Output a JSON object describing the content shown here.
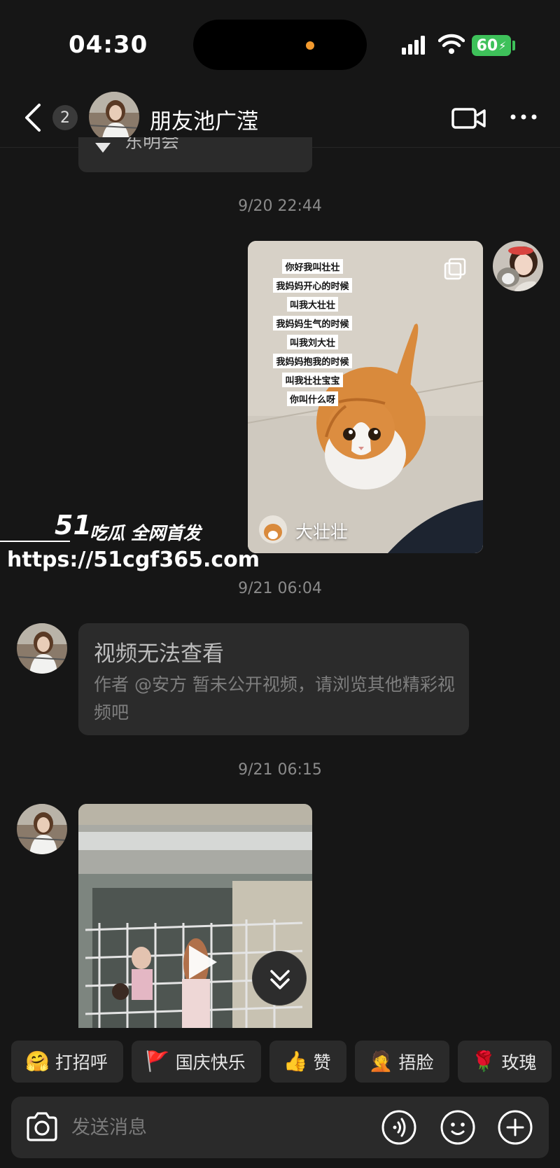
{
  "status_bar": {
    "time": "04:30",
    "battery": "60"
  },
  "header": {
    "back_badge": "2",
    "title": "朋友池广滢"
  },
  "partial_bubble": {
    "text": "东明会"
  },
  "messages": {
    "ts1": "9/20 22:44",
    "cat_video": {
      "caption_lines": [
        "你好我叫壮壮",
        "我妈妈开心的时候",
        "叫我大壮壮",
        "我妈妈生气的时候",
        "叫我刘大壮",
        "我妈妈抱我的时候",
        "叫我壮壮宝宝",
        "你叫什么呀"
      ],
      "author": "大壮壮"
    },
    "ts2": "9/21 06:04",
    "unavailable": {
      "title": "视频无法查看",
      "body": "作者 @安方 暂未公开视频，请浏览其他精彩视频吧"
    },
    "ts3": "9/21 06:15"
  },
  "watermark": {
    "logo": "51",
    "title": "吃瓜 全网首发",
    "url": "https://51cgf365.com"
  },
  "quick_replies": [
    {
      "emoji": "🤗",
      "label": "打招呼"
    },
    {
      "emoji": "🚩",
      "label": "国庆快乐"
    },
    {
      "emoji": "👍",
      "label": "赞"
    },
    {
      "emoji": "🤦",
      "label": "捂脸"
    },
    {
      "emoji": "🌹",
      "label": "玫瑰"
    }
  ],
  "input": {
    "placeholder": "发送消息"
  },
  "colors": {
    "background": "#161616",
    "bubble": "#2b2b2b",
    "battery": "#3ec15a",
    "island_dot": "#f29a2e"
  },
  "icons": [
    "back-icon",
    "video-call-icon",
    "more-icon",
    "copy-icon",
    "play-icon",
    "double-chevron-down-icon",
    "camera-icon",
    "voice-icon",
    "emoji-icon",
    "plus-icon"
  ]
}
